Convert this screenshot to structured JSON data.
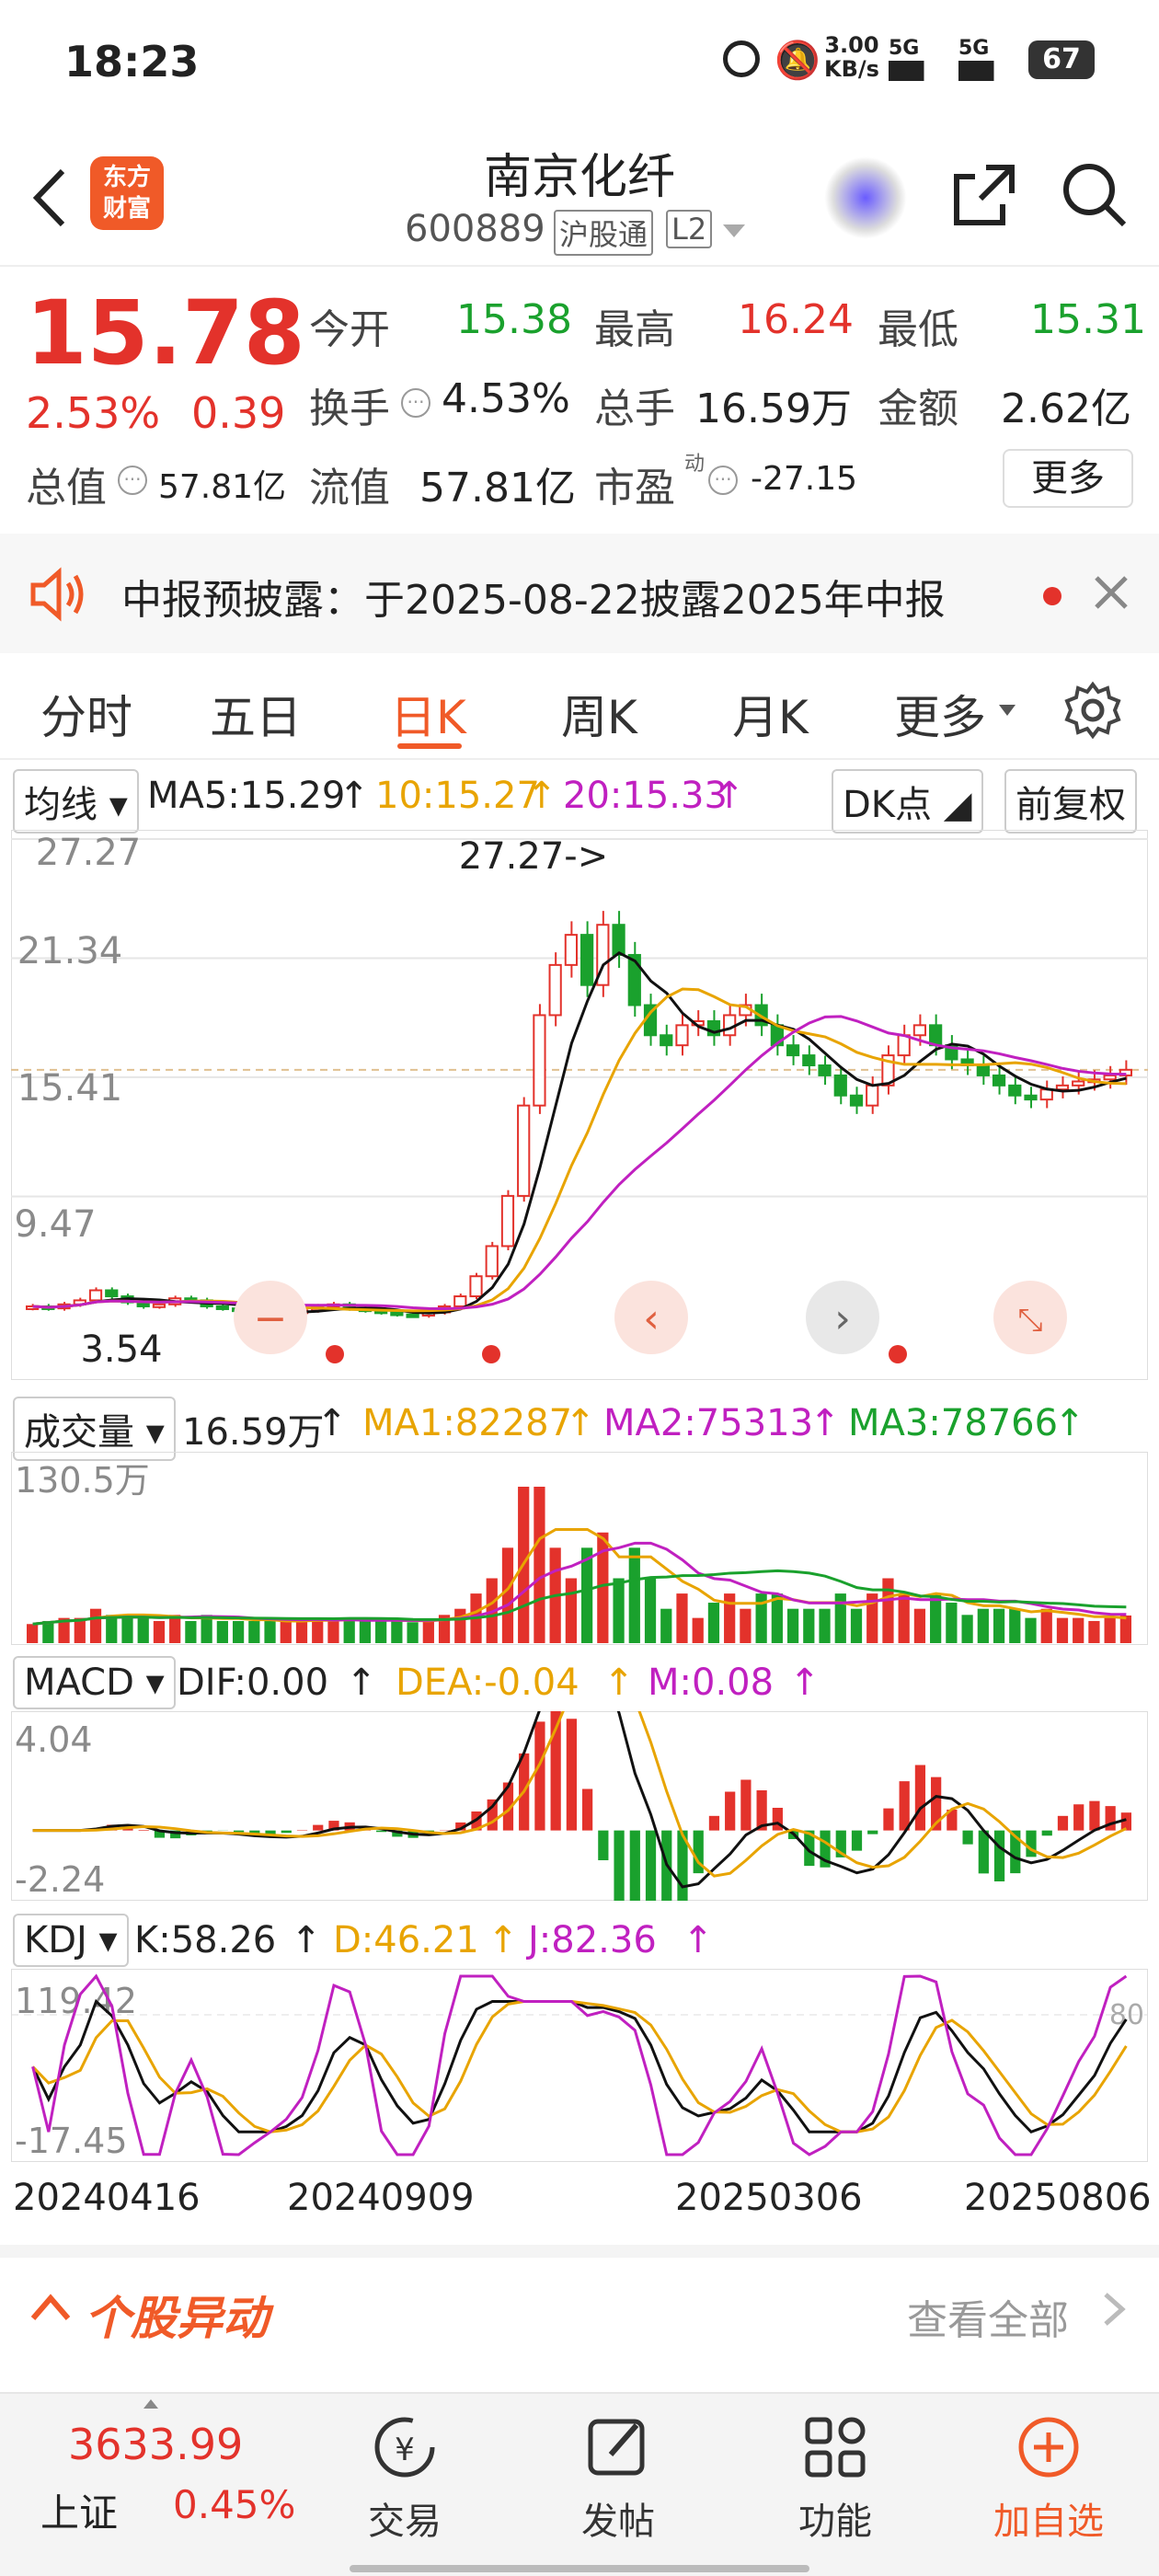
{
  "status": {
    "time": "18:23",
    "net_speed_top": "3.00",
    "net_speed_unit": "KB/s",
    "sig1": "5G",
    "sig2": "5G",
    "battery": "67"
  },
  "nav": {
    "title": "南京化纤",
    "code": "600889",
    "market_tag": "沪股通",
    "level_tag": "L2",
    "logo_top": "东方",
    "logo_bottom": "财富"
  },
  "quote": {
    "price": "15.78",
    "pct": "2.53%",
    "chg": "0.39",
    "open_label": "今开",
    "open": "15.38",
    "high_label": "最高",
    "high": "16.24",
    "low_label": "最低",
    "low": "15.31",
    "turnover_label": "换手",
    "turnover": "4.53%",
    "vol_label": "总手",
    "vol": "16.59万",
    "amount_label": "金额",
    "amount": "2.62亿",
    "mcap_label": "总值",
    "mcap": "57.81亿",
    "float_label": "流值",
    "float": "57.81亿",
    "pe_label": "市盈",
    "pe_sup": "动",
    "pe": "-27.15",
    "more": "更多"
  },
  "notice": {
    "text": "中报预披露：于2025-08-22披露2025年中报"
  },
  "tabs": [
    "分时",
    "五日",
    "日K",
    "周K",
    "月K",
    "更多"
  ],
  "active_tab": "日K",
  "ma": {
    "selector": "均线",
    "ma5": "MA5:15.29",
    "ma10": "10:15.27",
    "ma20": "20:15.33",
    "dk": "DK点",
    "fq": "前复权"
  },
  "kline": {
    "y_labels": [
      "27.27",
      "21.34",
      "15.41",
      "9.47"
    ],
    "low_label": "3.54",
    "high_marker": "27.27->"
  },
  "volume": {
    "selector": "成交量",
    "value": "16.59万",
    "ma1": "MA1:82287",
    "ma2": "MA2:75313",
    "ma3": "MA3:78766",
    "ymax": "130.5万"
  },
  "macd": {
    "selector": "MACD",
    "dif": "DIF:0.00",
    "dea": "DEA:-0.04",
    "m": "M:0.08",
    "ymax": "4.04",
    "ymin": "-2.24"
  },
  "kdj": {
    "selector": "KDJ",
    "k": "K:58.26",
    "d": "D:46.21",
    "j": "J:82.36",
    "ymax": "119.42",
    "ymin": "-17.45",
    "ref80": "80"
  },
  "dates": [
    "20240416",
    "20240909",
    "20250306",
    "20250806"
  ],
  "abnormal": {
    "title": "个股异动",
    "view_all": "查看全部"
  },
  "footer": {
    "index_value": "3633.99",
    "index_name": "上证",
    "index_pct": "0.45%",
    "items": [
      "交易",
      "发帖",
      "功能",
      "加自选"
    ]
  },
  "chart_data": {
    "type": "candlestick",
    "title": "",
    "price_close": [
      4.0,
      3.9,
      4.1,
      4.3,
      4.8,
      4.5,
      4.2,
      4.0,
      4.1,
      4.4,
      4.3,
      4.0,
      3.9,
      3.8,
      3.7,
      3.6,
      3.7,
      3.8,
      4.0,
      4.1,
      3.9,
      3.8,
      3.7,
      3.6,
      3.54,
      3.7,
      4.0,
      4.5,
      5.5,
      7.0,
      9.5,
      14.0,
      18.5,
      21.0,
      22.5,
      20.0,
      23.0,
      21.5,
      19.0,
      17.5,
      17.0,
      18.0,
      18.2,
      17.5,
      18.5,
      19.0,
      18.0,
      17.0,
      16.5,
      16.0,
      15.5,
      14.5,
      14.0,
      15.0,
      16.5,
      17.5,
      18.0,
      17.0,
      16.3,
      16.0,
      15.5,
      15.0,
      14.5,
      14.3,
      14.8,
      15.0,
      15.2,
      15.3,
      15.5,
      15.78
    ],
    "price_range": [
      3.54,
      27.27
    ],
    "ma_current": {
      "MA5": 15.29,
      "MA10": 15.27,
      "MA20": 15.33
    },
    "volume_ma": {
      "MA1": 82287,
      "MA2": 75313,
      "MA3": 78766
    },
    "macd_range": [
      -2.24,
      4.04
    ],
    "kdj_range": [
      -17.45,
      119.42
    ],
    "kdj_current": {
      "K": 58.26,
      "D": 46.21,
      "J": 82.36
    }
  }
}
